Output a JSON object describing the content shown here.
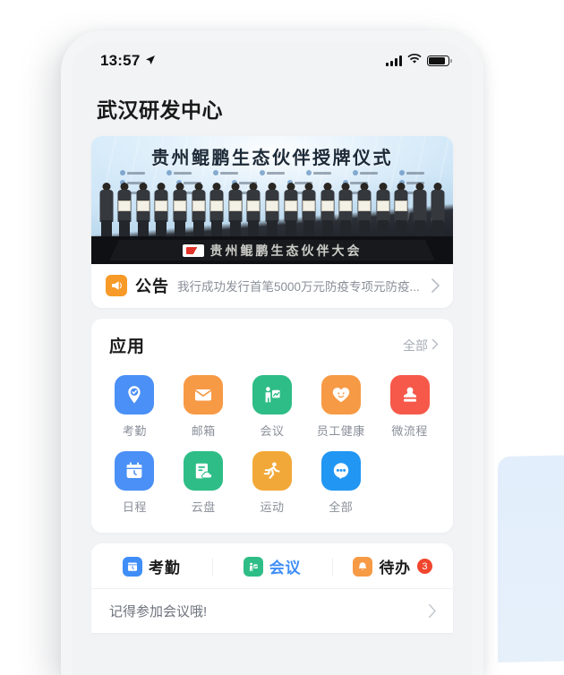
{
  "status_bar": {
    "time": "13:57",
    "location_icon": "location-arrow-icon",
    "signal_icon": "cellular-signal-icon",
    "wifi_icon": "wifi-icon",
    "battery_icon": "battery-icon"
  },
  "header": {
    "title": "武汉研发中心"
  },
  "banner": {
    "title": "贵州鲲鹏生态伙伴授牌仪式",
    "stage_text": "贵州鲲鹏生态伙伴大会",
    "alt": "授牌仪式合影"
  },
  "announcement": {
    "icon": "megaphone-icon",
    "label": "公告",
    "text": "我行成功发行首笔5000万元防疫专项元防疫...",
    "chevron": "chevron-right-icon"
  },
  "apps": {
    "title": "应用",
    "all_label": "全部",
    "all_chevron": "chevron-right-icon",
    "items": [
      {
        "label": "考勤",
        "icon": "attendance-pin-icon",
        "color": "#4a90f6"
      },
      {
        "label": "邮箱",
        "icon": "envelope-icon",
        "color": "#f79a45"
      },
      {
        "label": "会议",
        "icon": "presentation-icon",
        "color": "#2ebd86"
      },
      {
        "label": "员工健康",
        "icon": "heart-smile-icon",
        "color": "#f79a45"
      },
      {
        "label": "微流程",
        "icon": "stamp-icon",
        "color": "#f6594a"
      },
      {
        "label": "日程",
        "icon": "calendar-clock-icon",
        "color": "#4a90f6"
      },
      {
        "label": "云盘",
        "icon": "cloud-doc-icon",
        "color": "#2ebd86"
      },
      {
        "label": "运动",
        "icon": "running-icon",
        "color": "#f2a838"
      },
      {
        "label": "全部",
        "icon": "ellipsis-bubble-icon",
        "color": "#2196f3"
      }
    ]
  },
  "bottom_tabs": {
    "items": [
      {
        "label": "考勤",
        "icon": "attendance-tab-icon",
        "color": "#3f8ef7",
        "active": false,
        "badge": ""
      },
      {
        "label": "会议",
        "icon": "meeting-tab-icon",
        "color": "#2ebd86",
        "active": true,
        "badge": ""
      },
      {
        "label": "待办",
        "icon": "bell-tab-icon",
        "color": "#f79a45",
        "active": false,
        "badge": "3"
      }
    ],
    "list_item": {
      "text": "记得参加会议哦!",
      "chevron": "chevron-right-icon"
    }
  }
}
